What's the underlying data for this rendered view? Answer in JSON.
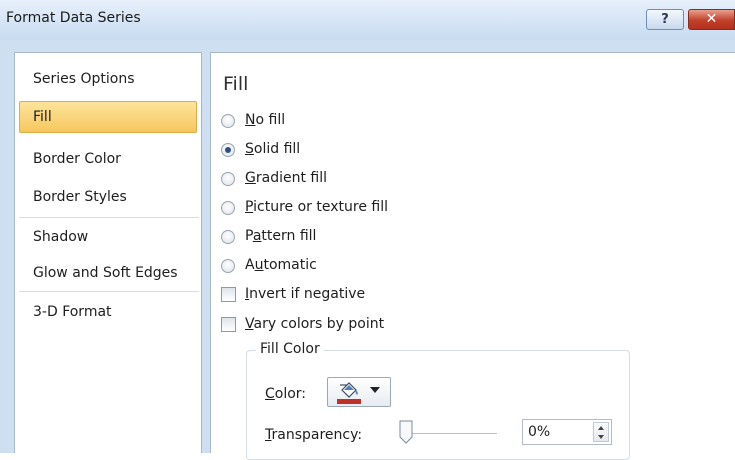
{
  "dialog": {
    "title": "Format Data Series",
    "help_label": "?",
    "close_label": "✕"
  },
  "sidebar": {
    "items": [
      {
        "label": "Series Options",
        "selected": false
      },
      {
        "label": "Fill",
        "selected": true
      },
      {
        "label": "Border Color",
        "selected": false
      },
      {
        "label": "Border Styles",
        "selected": false
      },
      {
        "label": "Shadow",
        "selected": false
      },
      {
        "label": "Glow and Soft Edges",
        "selected": false
      },
      {
        "label": "3-D Format",
        "selected": false
      }
    ]
  },
  "fill": {
    "heading": "Fill",
    "options": [
      {
        "pre": "",
        "key": "N",
        "post": "o fill",
        "checked": false
      },
      {
        "pre": "",
        "key": "S",
        "post": "olid fill",
        "checked": true
      },
      {
        "pre": "",
        "key": "G",
        "post": "radient fill",
        "checked": false
      },
      {
        "pre": "",
        "key": "P",
        "post": "icture or texture fill",
        "checked": false
      },
      {
        "pre": "P",
        "key": "a",
        "post": "ttern fill",
        "checked": false
      },
      {
        "pre": "A",
        "key": "u",
        "post": "tomatic",
        "checked": false
      }
    ],
    "checkboxes": [
      {
        "pre": "",
        "key": "I",
        "post": "nvert if negative",
        "checked": false
      },
      {
        "pre": "",
        "key": "V",
        "post": "ary colors by point",
        "checked": false
      }
    ],
    "fill_color": {
      "group_label": "Fill Color",
      "color_label_key": "C",
      "color_label_rest": "olor:",
      "color_icon": "paint-bucket-icon",
      "selected_color": "#c0302a",
      "transparency_label_key": "T",
      "transparency_label_rest": "ransparency:",
      "transparency_value": "0%",
      "transparency_fraction": 0.0
    }
  },
  "colors": {
    "titlebar": "#c8dbf1",
    "selected_item": "#f6c75e",
    "close_button": "#c0412b"
  }
}
